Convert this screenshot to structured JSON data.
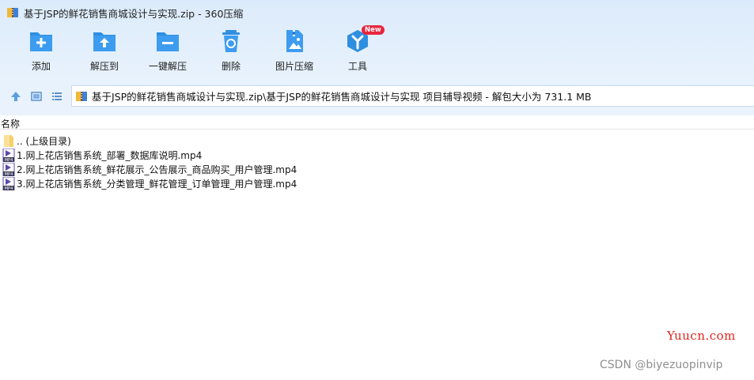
{
  "window": {
    "title": "基于JSP的鲜花销售商城设计与实现.zip - 360压缩"
  },
  "toolbar": {
    "tools": [
      {
        "label": "添加",
        "icon": "add-folder-icon"
      },
      {
        "label": "解压到",
        "icon": "extract-to-icon"
      },
      {
        "label": "一键解压",
        "icon": "one-click-extract-icon"
      },
      {
        "label": "删除",
        "icon": "trash-icon"
      },
      {
        "label": "图片压缩",
        "icon": "image-compress-icon"
      },
      {
        "label": "工具",
        "icon": "tools-icon",
        "badge": "New"
      }
    ]
  },
  "nav": {
    "path": "基于JSP的鲜花销售商城设计与实现.zip\\基于JSP的鲜花销售商城设计与实现 项目辅导视频 - 解包大小为 731.1 MB"
  },
  "list": {
    "column_name": "名称",
    "items": [
      {
        "label": ".. (上级目录)",
        "type": "parent-folder"
      },
      {
        "label": "1.网上花店销售系统_部署_数据库说明.mp4",
        "type": "mp4"
      },
      {
        "label": "2.网上花店销售系统_鲜花展示_公告展示_商品购买_用户管理.mp4",
        "type": "mp4"
      },
      {
        "label": "3.网上花店销售系统_分类管理_鲜花管理_订单管理_用户管理.mp4",
        "type": "mp4"
      }
    ]
  },
  "watermarks": {
    "site": "Yuucn.com",
    "csdn": "CSDN @biyezuopinvip"
  },
  "colors": {
    "accent_blue": "#2e8fe0",
    "badge_red": "#e8253c",
    "watermark_red": "#e0241c"
  }
}
